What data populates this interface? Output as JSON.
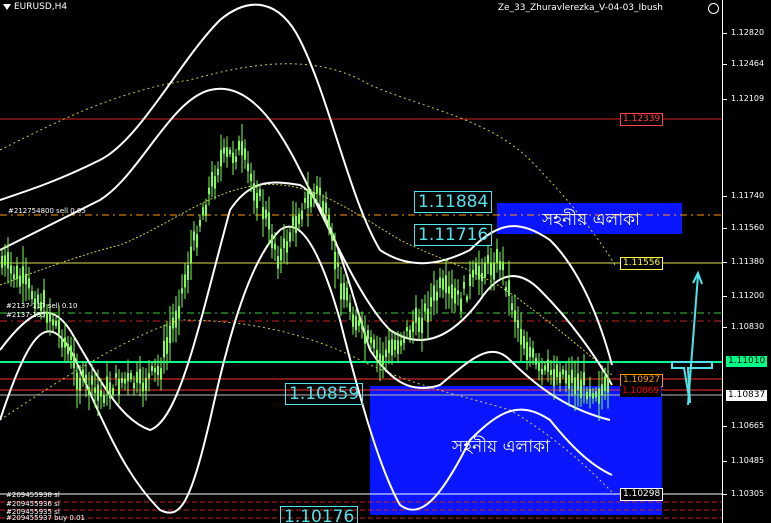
{
  "chart": {
    "symbol_title": "EURUSD,H4",
    "indicator_name": "Ze_33_Zhuravlerezka_V-04-03_Ibush",
    "price_axis_ticks": [
      "1.12820",
      "1.12464",
      "1.12109",
      "1.11740",
      "1.11560",
      "1.11380",
      "1.11200",
      "1.10830",
      "1.10665",
      "1.10485",
      "1.10305"
    ],
    "price_tags": [
      {
        "text": "1.12339",
        "color": "#ff4040",
        "bg": "#000000"
      },
      {
        "text": "1.11556",
        "color": "#ffff40",
        "bg": "#000000"
      },
      {
        "text": "1.11010",
        "color": "#000000",
        "bg": "#00ff88"
      },
      {
        "text": "1.10927",
        "color": "#ff9900",
        "bg": "#000000"
      },
      {
        "text": "1.10869",
        "color": "#ff0000",
        "bg": "#000000"
      },
      {
        "text": "1.10837",
        "color": "#000000",
        "bg": "#ffffff"
      },
      {
        "text": "1.10298",
        "color": "#ffffff",
        "bg": "#000000"
      }
    ],
    "level_labels": {
      "high1": "1.11884",
      "high2": "1.11716",
      "mid": "1.10859",
      "low": "1.10176"
    },
    "zone_text": {
      "upper": "সহনীয় এলাকা",
      "lower": "সহনীয় এলাকা"
    },
    "order_labels": {
      "sell1": "#212754800 sell 0.05",
      "sell2": "#2137-117 sell 0.10",
      "sell3": "#2137-135",
      "sl1": "#209455938 sl",
      "sl2": "#209455936 sl",
      "sl3": "#209455935 sl",
      "buy": "#209455937 buy 0.01"
    },
    "colors": {
      "background": "#000000",
      "candles": "#7cff4a",
      "bands": "#ffffff",
      "zone_fill": "#0a16ff",
      "arrow": "#4fe3ea"
    }
  }
}
